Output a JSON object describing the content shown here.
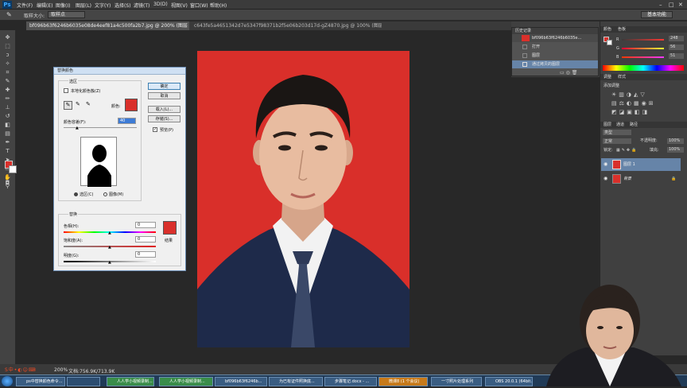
{
  "app": {
    "logo": "Ps",
    "menus": [
      "文件(F)",
      "编辑(E)",
      "图像(I)",
      "图层(L)",
      "文字(Y)",
      "选择(S)",
      "滤镜(T)",
      "3D(D)",
      "视图(V)",
      "窗口(W)",
      "帮助(H)"
    ]
  },
  "options": {
    "sample_label": "取样大小:",
    "sample_value": "取样点",
    "workspace": "基本功能"
  },
  "tabs": [
    {
      "label": "bf096b63f6246b6035e08de4eef81a4c500fa2b7.jpg @ 200% (图层 1, RGB/8) *"
    },
    {
      "label": "c643fe5a4651342d7e5347f98371b2f5e06b203d17d-gZ4870.jpg @ 100% (图层 1, RGB/8)"
    }
  ],
  "history": {
    "title": "历史记录",
    "snapshot": "bf096b63f6246b6035e...",
    "items": [
      "打开",
      "图层",
      "通过拷贝的图层"
    ]
  },
  "color_panel": {
    "tabs": [
      "颜色",
      "色板"
    ],
    "R": "248",
    "G": "56",
    "B": "51"
  },
  "adjust_panel": {
    "tabs": [
      "调整",
      "样式"
    ],
    "title": "添加调整"
  },
  "layers_panel": {
    "tabs": [
      "图层",
      "通道",
      "路径"
    ],
    "kind": "类型",
    "mode": "正常",
    "opacity_label": "不透明度:",
    "opacity": "100%",
    "lock_label": "锁定:",
    "fill_label": "填充:",
    "fill": "100%",
    "layers": [
      "图层 1",
      "背景"
    ]
  },
  "dialog": {
    "title": "替换颜色",
    "selection_group": "选区",
    "localized": "本地化颜色簇(Z)",
    "color_label": "颜色:",
    "fuzz_label": "颜色容差(F):",
    "fuzz_value": "40",
    "radio_selection": "选区(C)",
    "radio_image": "图像(M)",
    "ok": "确定",
    "cancel": "取消",
    "load": "载入(L)...",
    "save": "存储(S)...",
    "preview": "预览(P)",
    "replace_group": "替换",
    "hue_label": "色相(H):",
    "hue_value": "0",
    "sat_label": "饱和度(A):",
    "sat_value": "0",
    "light_label": "明度(G):",
    "light_value": "0",
    "result_label": "结果"
  },
  "status": {
    "zoom": "200%",
    "doc": "文档:756.9K/713.9K"
  },
  "taskbar": {
    "items": [
      "ps中替换颜色命令...",
      "人人学小视频录制...",
      "人人学小视频录制...",
      "bf096b63f6246b...",
      "为已有证件照换底...",
      "步骤笔记.docx - ...",
      "微课8 (1 个会议)",
      "一寸照片处理系列",
      "OBS 20.0.1 (64bit..."
    ]
  },
  "colors": {
    "accent": "#d9302b"
  }
}
